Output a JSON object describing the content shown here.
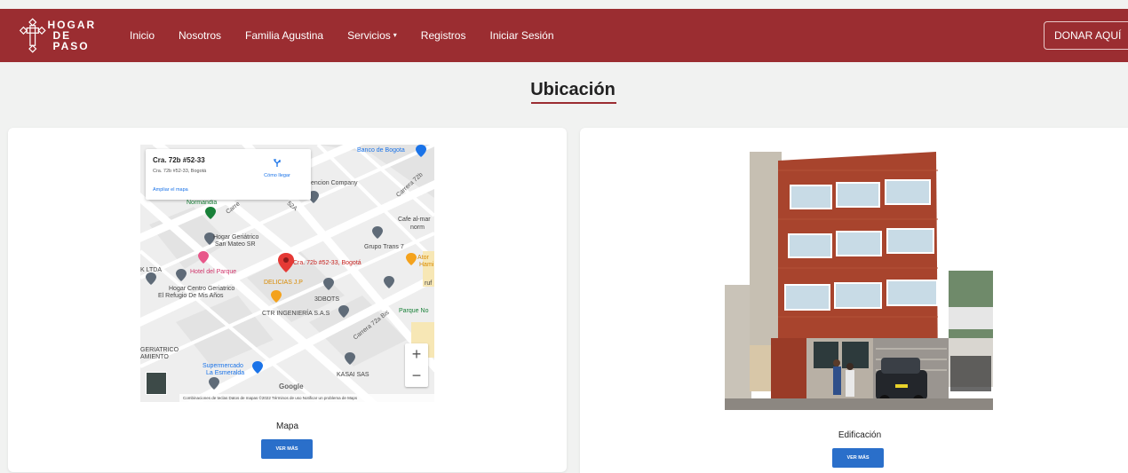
{
  "brand": {
    "line1": "HOGAR",
    "line2": "DE PASO",
    "icon": "cross-emblem-icon"
  },
  "nav": {
    "items": [
      {
        "label": "Inicio"
      },
      {
        "label": "Nosotros"
      },
      {
        "label": "Familia Agustina"
      },
      {
        "label": "Servicios",
        "caret": "▾"
      },
      {
        "label": "Registros"
      },
      {
        "label": "Iniciar Sesión"
      }
    ],
    "donate_label": "DONAR AQUÍ"
  },
  "page": {
    "title": "Ubicación"
  },
  "map_card": {
    "caption": "Mapa",
    "button_label": "VER MÁS",
    "popup": {
      "title": "Cra. 72b #52-33",
      "address": "Cra. 72b #52-33, Bogotá",
      "directions_label": "Cómo llegar",
      "enlarge_label": "Ampliar el mapa"
    },
    "labels": {
      "banco": "Banco de Bogota",
      "company": "encion Company",
      "carrera72b": "Carrera 72b",
      "normandia": "Normandia",
      "cafe1": "Cafe al-mar",
      "cafe2": "norm",
      "geriatrico1": "Hogar Geriátrico",
      "geriatrico2": "San Mateo SR",
      "grupo": "Grupo Trans 7",
      "marker": "Cra. 72b #52-33, Bogotá",
      "ltda": "K LTDA",
      "hotel": "Hotel del Parque",
      "delicias": "DELICIAS J.P",
      "centro1": "Hogar Centro Geriatrico",
      "centro2": "El Refugio De Mis Años",
      "bots": "3DBOTS",
      "ctr": "CTR INGENIERÍA S.A.S",
      "parque": "Parque No",
      "carrera72abis": "Carrera 72a Bis",
      "geriatrico3": "GERIATRICO",
      "amiento": "AMIENTO",
      "super1": "Supermercado",
      "super2": "La Esmeralda",
      "kasai": "KASAI SAS",
      "ator": "Ator",
      "hami": "Hami",
      "ruf": "ruf",
      "carre": "Carre",
      "calle52a": "52A",
      "google": "Google"
    },
    "footer": "Combinaciones de teclas   Datos de mapas ©2022   Términos de uso   Notificar un problema de Maps",
    "zoom_in": "+",
    "zoom_out": "−"
  },
  "building_card": {
    "caption": "Edificación",
    "button_label": "VER MÁS"
  },
  "colors": {
    "navbar": "#9b2d31",
    "button": "#2a6fca",
    "background": "#f1f2f1"
  }
}
